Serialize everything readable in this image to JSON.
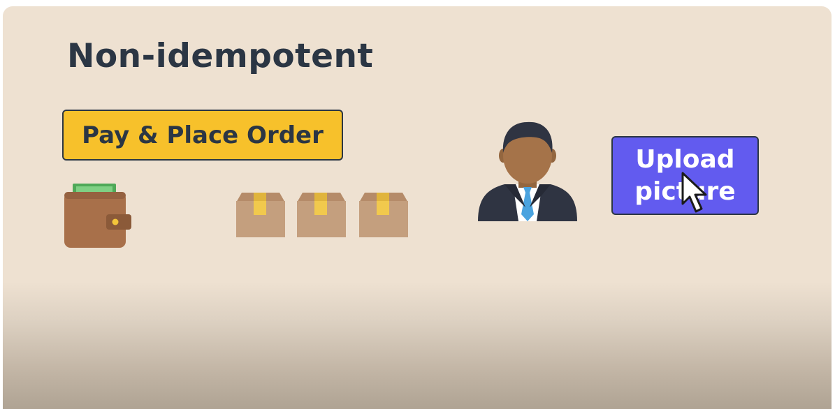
{
  "slide": {
    "title": "Non-idempotent",
    "pay_button_label": "Pay & Place Order",
    "upload_button_label": "Upload picture"
  },
  "icons": {
    "wallet": "wallet-icon",
    "boxes": [
      "package-box-icon",
      "package-box-icon",
      "package-box-icon"
    ],
    "person": "businessman-icon",
    "cursor": "mouse-pointer-icon"
  },
  "colors": {
    "background": "#eee1d1",
    "text_dark": "#2b3644",
    "pay_button": "#f7c12b",
    "upload_button": "#625bef"
  }
}
